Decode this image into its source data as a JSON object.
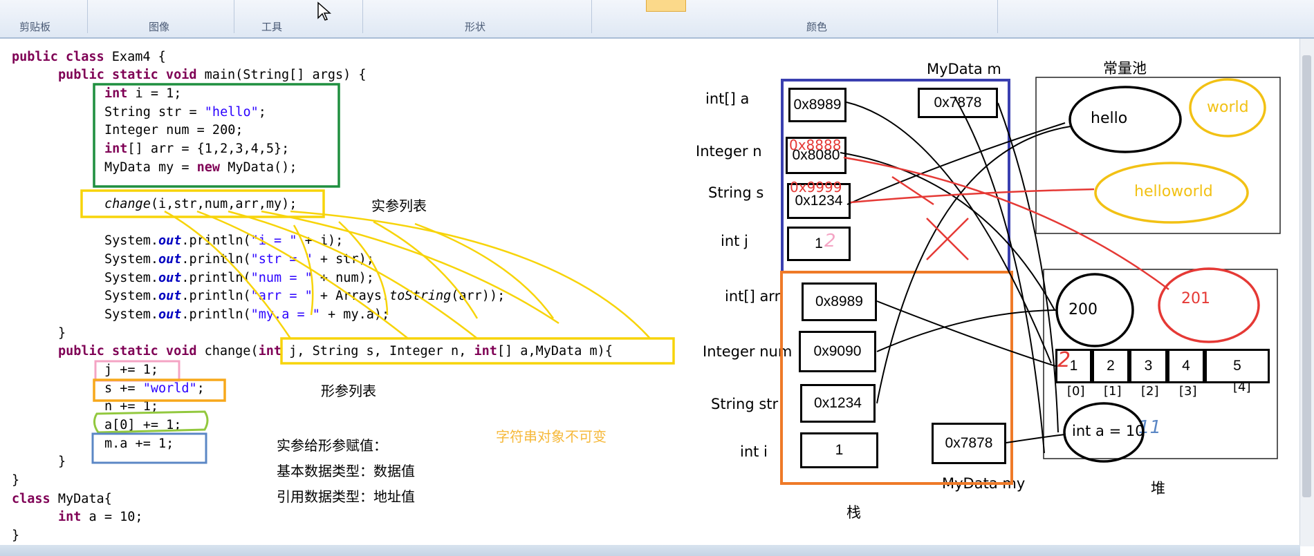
{
  "ribbon": {
    "groups": [
      "剪贴板",
      "图像",
      "工具",
      "形状",
      "颜色"
    ]
  },
  "code": {
    "class_decl": "public class Exam4 {",
    "main_decl": "public static void main(String[] args) {",
    "decl_lines": [
      "int i = 1;",
      "String str = \"hello\";",
      "Integer num = 200;",
      "int[] arr = {1,2,3,4,5};",
      "MyData my = new MyData();"
    ],
    "call_line": "change(i,str,num,arr,my);",
    "print_lines": [
      "System.out.println(\"i = \" + i);",
      "System.out.println(\"str = \" + str);",
      "System.out.println(\"num = \" + num);",
      "System.out.println(\"arr = \" + Arrays.toString(arr));",
      "System.out.println(\"my.a = \" + my.a);"
    ],
    "close_main": "}",
    "change_decl": "public static void change(int j, String s, Integer n, int[] a,MyData m){",
    "body_lines": [
      "j += 1;",
      "s += \"world\";",
      "n += 1;",
      "a[0] += 1;",
      "m.a += 1;"
    ],
    "close_change": "}",
    "close_class": "}",
    "mydata_decl": "class MyData{",
    "mydata_field": "int a = 10;",
    "mydata_close": "}"
  },
  "notes": {
    "actual_params": "实参列表",
    "formal_params": "形参列表",
    "string_immutable": "字符串对象不可变",
    "assign_title": "实参给形参赋值：",
    "assign_primitive": "基本数据类型：数据值",
    "assign_reference": "引用数据类型：地址值"
  },
  "diagram": {
    "mydata_m": "MyData m",
    "const_pool": "常量池",
    "stack": "栈",
    "heap": "堆",
    "mydata_my": "MyData my",
    "change_frame": [
      {
        "label": "int[]  a",
        "value": "0x8989"
      },
      {
        "label": "Integer n",
        "value": "0x8080",
        "overwrite": "0x8888"
      },
      {
        "label": "String  s",
        "value": "0x1234",
        "overwrite": "0x9999"
      },
      {
        "label": "int  j",
        "value": "1",
        "overwrite": "2"
      }
    ],
    "m_value": "0x7878",
    "main_frame": [
      {
        "label": "int[]    arr",
        "value": "0x8989"
      },
      {
        "label": "Integer num",
        "value": "0x9090"
      },
      {
        "label": "String str",
        "value": "0x1234"
      },
      {
        "label": "int  i",
        "value": "1"
      }
    ],
    "my_value": "0x7878",
    "pool": [
      "hello",
      "world",
      "helloworld"
    ],
    "heap_ints": [
      "200",
      "201"
    ],
    "array_values": [
      "1",
      "2",
      "3",
      "4",
      "5"
    ],
    "array_overwrite": "2",
    "array_indices": [
      "[0]",
      "[1]",
      "[2]",
      "[3]",
      "[4]"
    ],
    "object_field": "int a = 10",
    "object_overwrite": "11"
  },
  "colors": {
    "green": "#1f8f3f",
    "yellow": "#f7d40a",
    "pink": "#f4a4c4",
    "lime": "#92c83e",
    "steel": "#5b87c5",
    "navy": "#3a3fb0",
    "orange": "#ef7a28",
    "red": "#e53935",
    "gold": "#f2c114"
  }
}
